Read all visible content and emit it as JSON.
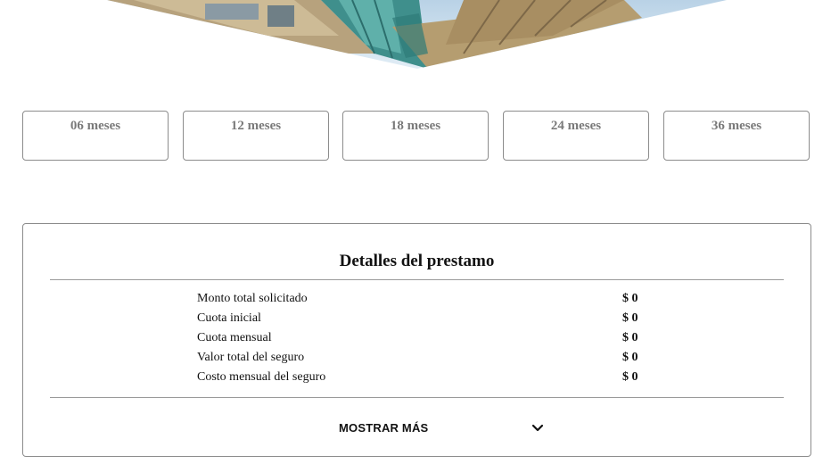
{
  "hero": {
    "image": "building-photo",
    "colors": {
      "sky": "#cfe0ee",
      "glass": "#3f8f8c",
      "facade": "#b9a47c"
    }
  },
  "terms": [
    {
      "label": "06 meses"
    },
    {
      "label": "12 meses"
    },
    {
      "label": "18 meses"
    },
    {
      "label": "24 meses"
    },
    {
      "label": "36 meses"
    }
  ],
  "details": {
    "title": "Detalles del prestamo",
    "rows": [
      {
        "label": "Monto total solicitado",
        "value": "$ 0"
      },
      {
        "label": "Cuota inicial",
        "value": "$ 0"
      },
      {
        "label": "Cuota mensual",
        "value": "$ 0"
      },
      {
        "label": "Valor total del seguro",
        "value": "$ 0"
      },
      {
        "label": "Costo mensual del seguro",
        "value": "$ 0"
      }
    ],
    "more_label": "MOSTRAR MÁS",
    "more_icon": "chevron-down-icon"
  }
}
